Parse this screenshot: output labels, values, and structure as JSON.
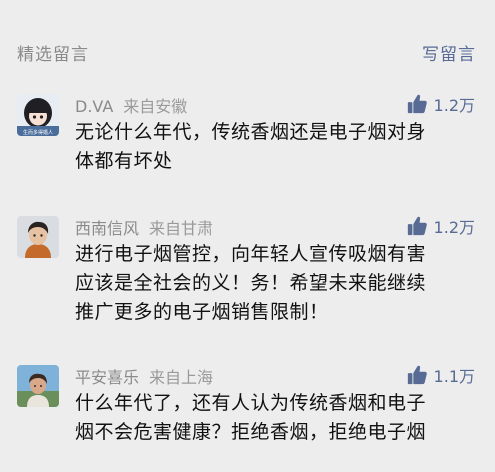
{
  "header": {
    "title": "精选留言",
    "write_label": "写留言"
  },
  "colors": {
    "link": "#576b95",
    "muted": "#8a8a8a",
    "text": "#111111",
    "background": "#ededed"
  },
  "comments": [
    {
      "nickname": "D.VA",
      "location": "来自安徽",
      "likes": "1.2万",
      "avatar_icon": "anime-girl-avatar-icon",
      "avatar_caption": "生而多得婚人",
      "lines": [
        "无论什么年代，传统香烟还是电子烟对身",
        "体都有坏处"
      ]
    },
    {
      "nickname": "西南信风",
      "location": "来自甘肃",
      "likes": "1.2万",
      "avatar_icon": "person-photo-avatar-icon",
      "lines": [
        "进行电子烟管控，向年轻人宣传吸烟有害",
        "应该是全社会的义！务！希望未来能继续",
        "推广更多的电子烟销售限制！"
      ]
    },
    {
      "nickname": "平安喜乐",
      "location": "来自上海",
      "likes": "1.1万",
      "avatar_icon": "outdoor-photo-avatar-icon",
      "lines": [
        "什么年代了，还有人认为传统香烟和电子",
        "烟不会危害健康？拒绝香烟，拒绝电子烟"
      ]
    }
  ]
}
